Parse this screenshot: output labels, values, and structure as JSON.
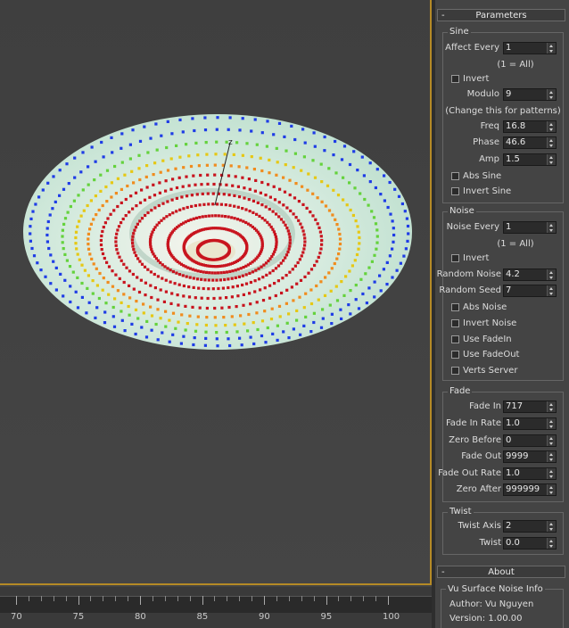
{
  "parameters": {
    "title": "Parameters",
    "collapse_symbol": "-",
    "sine": {
      "group_label": "Sine",
      "affect_every": {
        "label": "Affect Every",
        "value": "1"
      },
      "affect_note": "(1 = All)",
      "invert_label": "Invert",
      "modulo": {
        "label": "Modulo",
        "value": "9"
      },
      "pattern_note": "(Change this for patterns)",
      "freq": {
        "label": "Freq",
        "value": "16.8"
      },
      "phase": {
        "label": "Phase",
        "value": "46.6"
      },
      "amp": {
        "label": "Amp",
        "value": "1.5"
      },
      "abs_sine_label": "Abs Sine",
      "invert_sine_label": "Invert Sine"
    },
    "noise": {
      "group_label": "Noise",
      "noise_every": {
        "label": "Noise Every",
        "value": "1"
      },
      "noise_note": "(1 = All)",
      "invert_label": "Invert",
      "random_noise": {
        "label": "Random Noise",
        "value": "4.2"
      },
      "random_seed": {
        "label": "Random Seed",
        "value": "7"
      },
      "abs_noise_label": "Abs Noise",
      "invert_noise_label": "Invert Noise",
      "use_fadein_label": "Use FadeIn",
      "use_fadeout_label": "Use FadeOut",
      "verts_server_label": "Verts Server"
    },
    "fade": {
      "group_label": "Fade",
      "fade_in": {
        "label": "Fade In",
        "value": "717"
      },
      "fade_in_rate": {
        "label": "Fade In Rate",
        "value": "1.0"
      },
      "zero_before": {
        "label": "Zero Before",
        "value": "0"
      },
      "fade_out": {
        "label": "Fade Out",
        "value": "9999"
      },
      "fade_out_rate": {
        "label": "Fade Out Rate",
        "value": "1.0"
      },
      "zero_after": {
        "label": "Zero After",
        "value": "999999"
      }
    },
    "twist": {
      "group_label": "Twist",
      "twist_axis": {
        "label": "Twist Axis",
        "value": "2"
      },
      "twist": {
        "label": "Twist",
        "value": "0.0"
      }
    }
  },
  "about": {
    "title": "About",
    "collapse_symbol": "-",
    "group_label": "Vu Surface Noise Info",
    "author": "Author: Vu Nguyen",
    "version": "Version: 1.00.00"
  },
  "viewport": {
    "axis_label": "z",
    "surface_color": "#cfe8d8",
    "inner_point_color": "#c8141e",
    "mid_point_color": "#f08c1e",
    "outer_point_color": "#1e3ce6"
  },
  "timeline": {
    "labels": [
      "70",
      "75",
      "80",
      "85",
      "90",
      "95",
      "100"
    ]
  }
}
